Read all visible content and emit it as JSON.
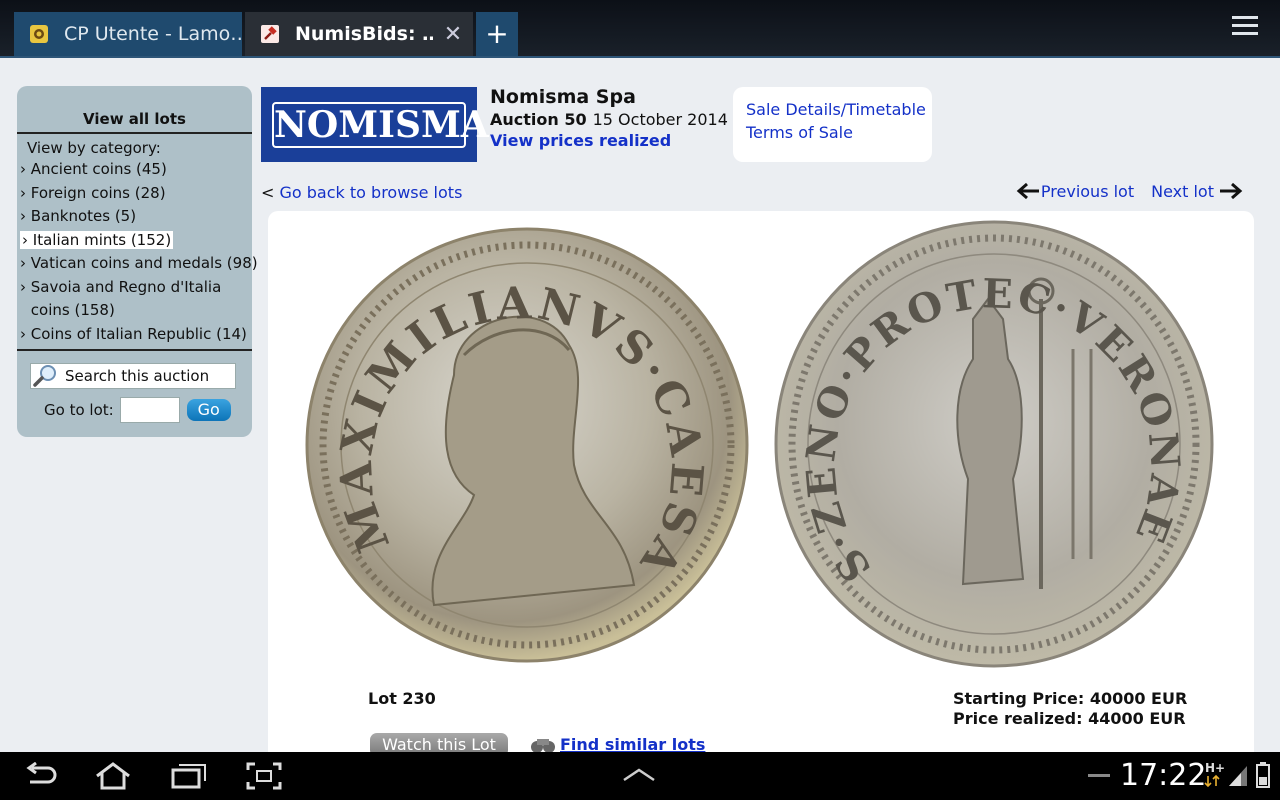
{
  "browser": {
    "tabs": [
      {
        "title": "CP Utente - Lamo…",
        "icon": "lens-icon"
      },
      {
        "title": "NumisBids: …",
        "icon": "gavel-icon",
        "close": "✕"
      }
    ],
    "new_tab": "+"
  },
  "sidebar": {
    "view_all": "View all lots",
    "view_by": "View by category:",
    "categories": [
      {
        "label": "Ancient coins (45)"
      },
      {
        "label": "Foreign coins (28)"
      },
      {
        "label": "Banknotes (5)"
      },
      {
        "label": "Italian mints (152)",
        "selected": true
      },
      {
        "label": "Vatican coins and medals (98)"
      },
      {
        "label": "Savoia and Regno d'Italia coins (158)"
      },
      {
        "label": "Coins of Italian Republic (14)"
      }
    ],
    "search_placeholder": "Search this auction",
    "goto_label": "Go to lot:",
    "go_button": "Go"
  },
  "header": {
    "logo_text": "NOMISMA",
    "company": "Nomisma Spa",
    "auction": "Auction 50",
    "date": "15 October 2014",
    "prices_link": "View prices realized",
    "sale_details": "Sale Details/Timetable",
    "terms": "Terms of Sale"
  },
  "nav": {
    "back_prefix": "<",
    "back": "Go back to browse lots",
    "previous": "Previous lot",
    "next": "Next lot"
  },
  "lot": {
    "number": "Lot 230",
    "starting_price": "Starting Price: 40000 EUR",
    "price_realized": "Price realized: 44000 EUR",
    "watch": "Watch this Lot",
    "similar": "Find similar lots",
    "obverse_legend": "MAXIMILIANVS·CAESAR",
    "reverse_legend": "S·ZENO·PROTEC·VERONAE"
  },
  "status": {
    "time": "17:22"
  },
  "colors": {
    "link": "#1431c8",
    "sidebar": "#aec0c8",
    "logo_bg": "#1a3f99",
    "page_bg": "#ebeef2"
  }
}
